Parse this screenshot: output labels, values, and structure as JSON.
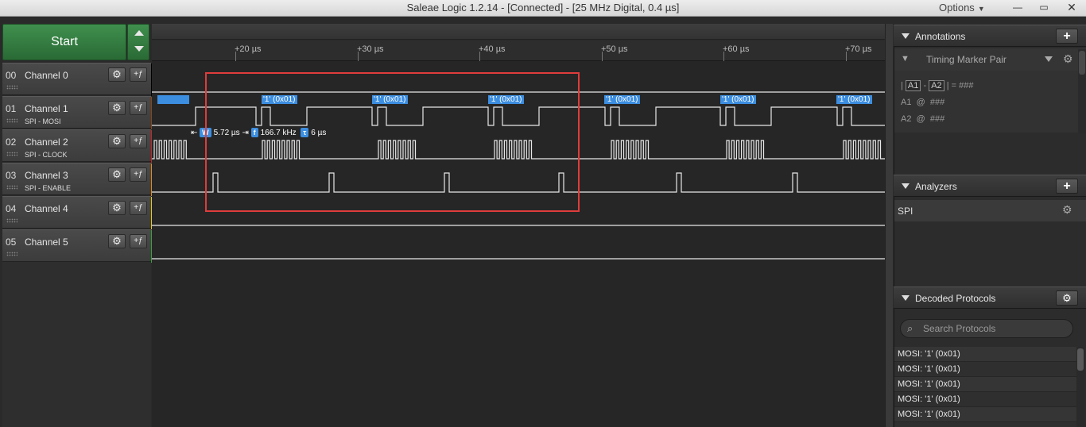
{
  "window": {
    "title": "Saleae Logic 1.2.14 - [Connected] - [25 MHz Digital, 0.4 µs]",
    "options_label": "Options",
    "min": "—",
    "max": "▭",
    "close": "✕"
  },
  "start_button": "Start",
  "timeline": {
    "ticks": [
      "+20 µs",
      "+30 µs",
      "+40 µs",
      "+50 µs",
      "+60 µs",
      "+70 µs"
    ]
  },
  "channels": [
    {
      "num": "00",
      "name": "Channel 0",
      "sub": "",
      "color": "#000000"
    },
    {
      "num": "01",
      "name": "Channel 1",
      "sub": "SPI - MOSI",
      "color": "#8b4513"
    },
    {
      "num": "02",
      "name": "Channel 2",
      "sub": "SPI - CLOCK",
      "color": "#d42020"
    },
    {
      "num": "03",
      "name": "Channel 3",
      "sub": "SPI - ENABLE",
      "color": "#e08a1a"
    },
    {
      "num": "04",
      "name": "Channel 4",
      "sub": "",
      "color": "#e6c81e"
    },
    {
      "num": "05",
      "name": "Channel 5",
      "sub": "",
      "color": "#3ca03c"
    }
  ],
  "decoded_frames": [
    "'1' (0x01)",
    "'1' (0x01)",
    "'1' (0x01)",
    "'1' (0x01)",
    "'1' (0x01)",
    "'1' (0x01)"
  ],
  "measurement": {
    "width_icon": "W",
    "width": "5.72 µs",
    "freq_icon": "f",
    "freq": "166.7 kHz",
    "period_icon": "τ",
    "period": "6 µs"
  },
  "annotations": {
    "header": "Annotations",
    "add": "+",
    "marker_pair": "Timing Marker Pair",
    "a1": "A1",
    "a2": "A2",
    "diff_value": "###",
    "a1_value": "###",
    "a2_value": "###",
    "at": "@",
    "sep_bar": "|",
    "sep_minus": "-",
    "sep_eq": "| =",
    "a1_label": "A1",
    "a2_label": "A2"
  },
  "analyzers": {
    "header": "Analyzers",
    "add": "+",
    "items": [
      "SPI"
    ]
  },
  "decoded_protocols": {
    "header": "Decoded Protocols",
    "search_placeholder": "Search Protocols",
    "items": [
      "MOSI: '1' (0x01)",
      "MOSI: '1' (0x01)",
      "MOSI: '1' (0x01)",
      "MOSI: '1' (0x01)",
      "MOSI: '1' (0x01)"
    ]
  },
  "icons": {
    "gear": "gear-icon",
    "trigger": "trigger-icon",
    "search": "search-icon",
    "pin": "pin-icon"
  },
  "accent_color": "#3c8ee0",
  "highlight_color": "#e03c3c"
}
